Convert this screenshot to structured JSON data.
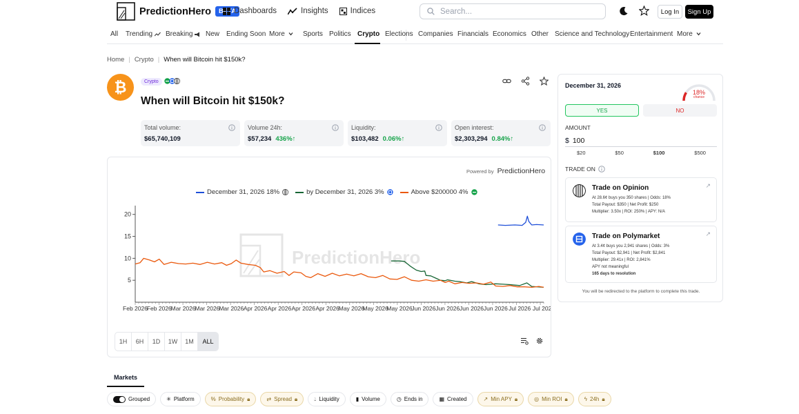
{
  "header": {
    "brand": "PredictionHero",
    "beta": "BETA",
    "nav": [
      "Dashboards",
      "Insights",
      "Indices"
    ],
    "search_placeholder": "Search...",
    "login": "Log In",
    "signup": "Sign Up"
  },
  "categories": {
    "all": "All",
    "trending": "Trending",
    "breaking": "Breaking",
    "new": "New",
    "ending_soon": "Ending Soon",
    "more1": "More",
    "sports": "Sports",
    "politics": "Politics",
    "crypto": "Crypto",
    "elections": "Elections",
    "companies": "Companies",
    "financials": "Financials",
    "economics": "Economics",
    "other": "Other",
    "science": "Science and Technology",
    "entertainment": "Entertainment",
    "more2": "More"
  },
  "breadcrumb": [
    "Home",
    "Crypto",
    "When will Bitcoin hit $150k?"
  ],
  "market": {
    "tag": "Crypto",
    "title": "When will Bitcoin hit $150k?",
    "stats": [
      {
        "label": "Total volume:",
        "value": "$65,740,109",
        "change": ""
      },
      {
        "label": "Volume 24h:",
        "value": "$57,234",
        "change": "436%"
      },
      {
        "label": "Liquidity:",
        "value": "$103,482",
        "change": "0.06%"
      },
      {
        "label": "Open interest:",
        "value": "$2,303,294",
        "change": "0.84%"
      }
    ]
  },
  "chart": {
    "powered_prefix": "Powered by",
    "powered_brand": "PredictionHero",
    "watermark": "PredictionHero",
    "legend": [
      {
        "label": "December 31, 2026 18%",
        "color": "#1d4ed8"
      },
      {
        "label": "by December 31, 2026 3%",
        "color": "#166534"
      },
      {
        "label": "Above $200000 4%",
        "color": "#ea580c"
      }
    ],
    "ranges": [
      "1H",
      "6H",
      "1D",
      "1W",
      "1M",
      "ALL"
    ]
  },
  "chart_data": {
    "type": "line",
    "y_ticks": [
      5,
      10,
      15,
      20
    ],
    "ylim": [
      0,
      22
    ],
    "x_tick_labels": [
      "Feb 2026",
      "Feb 2026",
      "Mar 2026",
      "Mar 2026",
      "Mar 2026",
      "Apr 2026",
      "Apr 2026",
      "Apr 2026",
      "Apr 2026",
      "May 2026",
      "May 2026",
      "May 2026",
      "Jun 2026",
      "Jun 2026",
      "Jun 2026",
      "Jun 2026",
      "Jul 2026",
      "Jul 2026"
    ],
    "x_start": 0,
    "x_end": 17,
    "series": [
      {
        "name": "December 31, 2026",
        "color": "#1d4ed8",
        "points": [
          [
            15.1,
            17.6
          ],
          [
            15.4,
            17.5
          ],
          [
            15.8,
            17.6
          ],
          [
            16.1,
            17.5
          ],
          [
            16.25,
            18.2
          ],
          [
            16.32,
            19.6
          ],
          [
            16.38,
            18.4
          ],
          [
            16.5,
            17.6
          ],
          [
            16.7,
            17.7
          ],
          [
            17,
            17.6
          ]
        ]
      },
      {
        "name": "by December 31, 2026",
        "color": "#166534",
        "points": [
          [
            10.65,
            9.4
          ],
          [
            11,
            9.4
          ],
          [
            11.2,
            9.3
          ],
          [
            11.45,
            8.2
          ],
          [
            11.7,
            7.3
          ],
          [
            11.9,
            7.0
          ],
          [
            12.05,
            7.1
          ],
          [
            12.1,
            6.1
          ],
          [
            12.3,
            6.0
          ],
          [
            12.5,
            5.5
          ],
          [
            12.7,
            5.0
          ],
          [
            12.9,
            4.9
          ],
          [
            13,
            5.1
          ],
          [
            13.3,
            4.8
          ],
          [
            13.5,
            4.7
          ],
          [
            13.8,
            4.4
          ],
          [
            14,
            4.7
          ],
          [
            14.3,
            4.2
          ],
          [
            14.6,
            4.0
          ],
          [
            15,
            4.2
          ],
          [
            15.3,
            4.1
          ],
          [
            15.6,
            4.0
          ],
          [
            16,
            3.8
          ],
          [
            16.3,
            4.4
          ],
          [
            16.5,
            3.6
          ],
          [
            17,
            3.4
          ]
        ]
      },
      {
        "name": "Above $200000",
        "color": "#ea580c",
        "points": [
          [
            0,
            8.7
          ],
          [
            0.2,
            9.0
          ],
          [
            0.35,
            10.0
          ],
          [
            0.6,
            9.6
          ],
          [
            0.8,
            9.2
          ],
          [
            1.0,
            9.8
          ],
          [
            1.2,
            8.6
          ],
          [
            1.5,
            9.1
          ],
          [
            1.8,
            8.8
          ],
          [
            2.1,
            8.7
          ],
          [
            2.4,
            8.9
          ],
          [
            2.7,
            8.6
          ],
          [
            3.0,
            9.1
          ],
          [
            3.3,
            8.7
          ],
          [
            3.6,
            9.0
          ],
          [
            3.8,
            8.4
          ],
          [
            4.0,
            8.8
          ],
          [
            4.2,
            9.6
          ],
          [
            4.4,
            8.9
          ],
          [
            4.7,
            8.6
          ],
          [
            5.0,
            8.4
          ],
          [
            5.2,
            7.9
          ],
          [
            5.35,
            6.9
          ],
          [
            5.6,
            7.2
          ],
          [
            5.9,
            6.6
          ],
          [
            6.2,
            7.0
          ],
          [
            6.4,
            6.1
          ],
          [
            6.6,
            6.9
          ],
          [
            6.9,
            6.7
          ],
          [
            7.1,
            5.9
          ],
          [
            7.3,
            5.6
          ],
          [
            7.6,
            6.5
          ],
          [
            7.9,
            5.9
          ],
          [
            8.2,
            6.6
          ],
          [
            8.5,
            6.0
          ],
          [
            8.8,
            6.4
          ],
          [
            9.1,
            6.0
          ],
          [
            9.4,
            6.5
          ],
          [
            9.7,
            5.8
          ],
          [
            10.0,
            5.6
          ],
          [
            10.3,
            6.1
          ],
          [
            10.6,
            5.3
          ],
          [
            10.9,
            5.2
          ],
          [
            11.2,
            5.8
          ],
          [
            11.5,
            5.0
          ],
          [
            11.8,
            4.8
          ],
          [
            12.1,
            5.1
          ],
          [
            12.4,
            4.8
          ],
          [
            12.7,
            5.0
          ],
          [
            12.9,
            4.5
          ],
          [
            13.05,
            4.8
          ],
          [
            13.3,
            4.2
          ],
          [
            13.6,
            4.5
          ],
          [
            13.9,
            4.3
          ],
          [
            14.2,
            4.4
          ],
          [
            14.5,
            4.1
          ],
          [
            14.8,
            4.6
          ],
          [
            15.0,
            3.7
          ],
          [
            15.3,
            3.6
          ],
          [
            15.6,
            3.8
          ],
          [
            15.9,
            3.5
          ],
          [
            16.2,
            3.5
          ],
          [
            16.5,
            3.4
          ],
          [
            16.8,
            3.6
          ],
          [
            17,
            3.4
          ]
        ]
      }
    ]
  },
  "trade": {
    "date": "December 31, 2026",
    "chance_pct": "18%",
    "chance_label": "chance",
    "chance_value": 18,
    "yes": "YES",
    "no": "NO",
    "amount_label": "AMOUNT",
    "currency": "$",
    "amount": "100",
    "presets": [
      "$20",
      "$50",
      "$100",
      "$500"
    ],
    "trade_on": "TRADE ON",
    "opinion": {
      "title": "Trade on Opinion",
      "line1": "At 28.6¢ buys you 350 shares | Odds: 18%",
      "line2": "Total Payout: $350 | Net Profit: $250",
      "line3": "Multiplier: 3.50x | ROI: 250% | APY: N/A"
    },
    "polymarket": {
      "title": "Trade on Polymarket",
      "line1": "At 3.4¢ buys you 2,941 shares | Odds: 3%",
      "line2": "Total Payout: $2,941 | Net Profit: $2,841",
      "line3": "Multiplier: 29.41x | ROI: 2,841%",
      "line4": "APY not meaningful",
      "line5": "165 days to resolution"
    },
    "disclaimer": "You will be redirected to the platform to complete this trade."
  },
  "markets": {
    "tab": "Markets",
    "filters": [
      "Grouped",
      "Platform",
      "Probability",
      "Spread",
      "Liquidity",
      "Volume",
      "Ends in",
      "Created",
      "Min APY",
      "Min ROI",
      "24h"
    ]
  }
}
